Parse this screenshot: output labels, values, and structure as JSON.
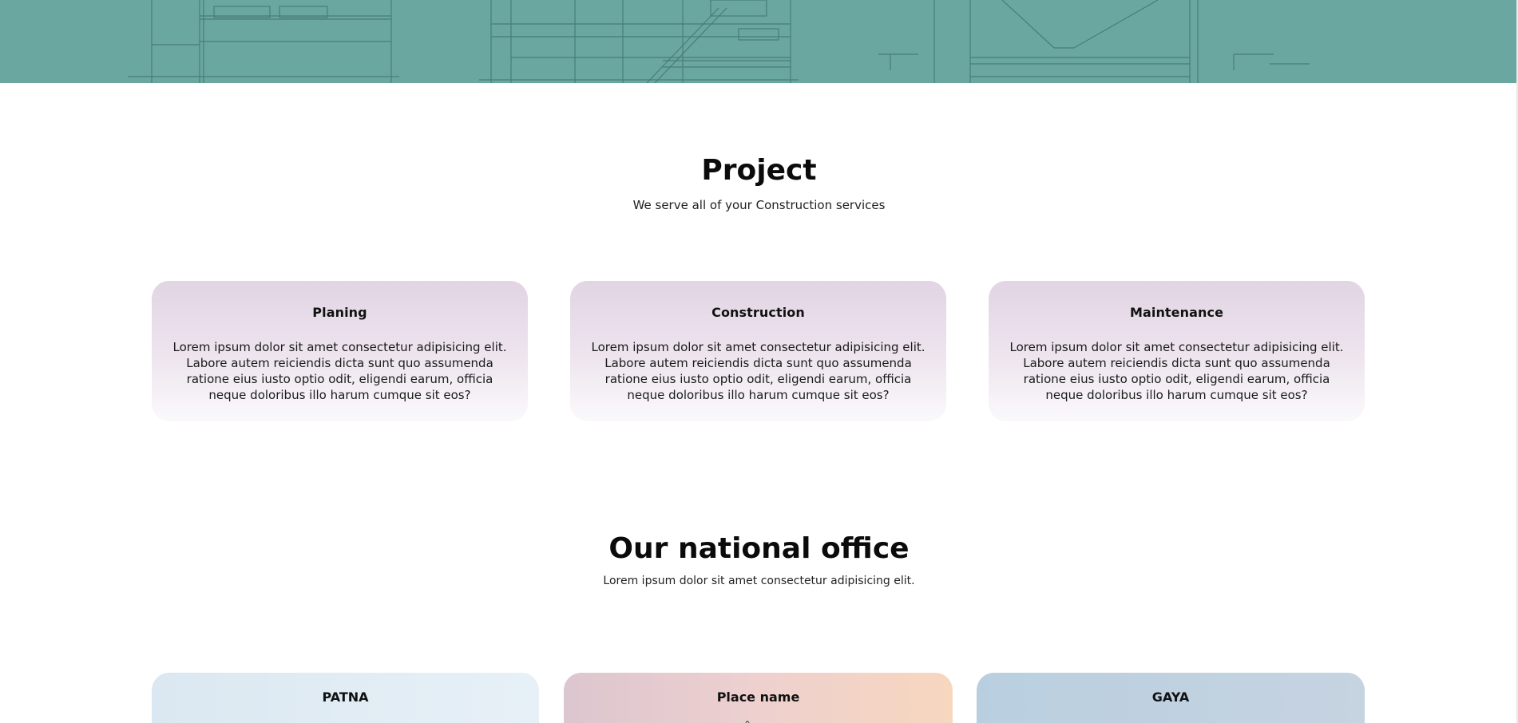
{
  "hero": {
    "image": "blueprint-banner",
    "bg_color": "#6aa7a0"
  },
  "project": {
    "title": "Project",
    "subtitle": "We serve all of your Construction services",
    "cards": [
      {
        "title": "Planing",
        "body": "Lorem ipsum dolor sit amet consectetur adipisicing elit. Labore autem reiciendis dicta sunt quo assumenda ratione eius iusto optio odit, eligendi earum, officia neque doloribus illo harum cumque sit eos?"
      },
      {
        "title": "Construction",
        "body": "Lorem ipsum dolor sit amet consectetur adipisicing elit. Labore autem reiciendis dicta sunt quo assumenda ratione eius iusto optio odit, eligendi earum, officia neque doloribus illo harum cumque sit eos?"
      },
      {
        "title": "Maintenance",
        "body": "Lorem ipsum dolor sit amet consectetur adipisicing elit. Labore autem reiciendis dicta sunt quo assumenda ratione eius iusto optio odit, eligendi earum, officia neque doloribus illo harum cumque sit eos?"
      }
    ]
  },
  "offices": {
    "title": "Our national office",
    "subtitle": "Lorem ipsum dolor sit amet consectetur adipisicing elit.",
    "items": [
      {
        "name": "PATNA"
      },
      {
        "name": "Place name"
      },
      {
        "name": "GAYA"
      }
    ]
  },
  "colors": {
    "card_gradient_top": "#e1d4e3",
    "office_patna": "#dbe8f1",
    "office_place": "#eed0cf",
    "office_gaya": "#b9cfe0"
  }
}
